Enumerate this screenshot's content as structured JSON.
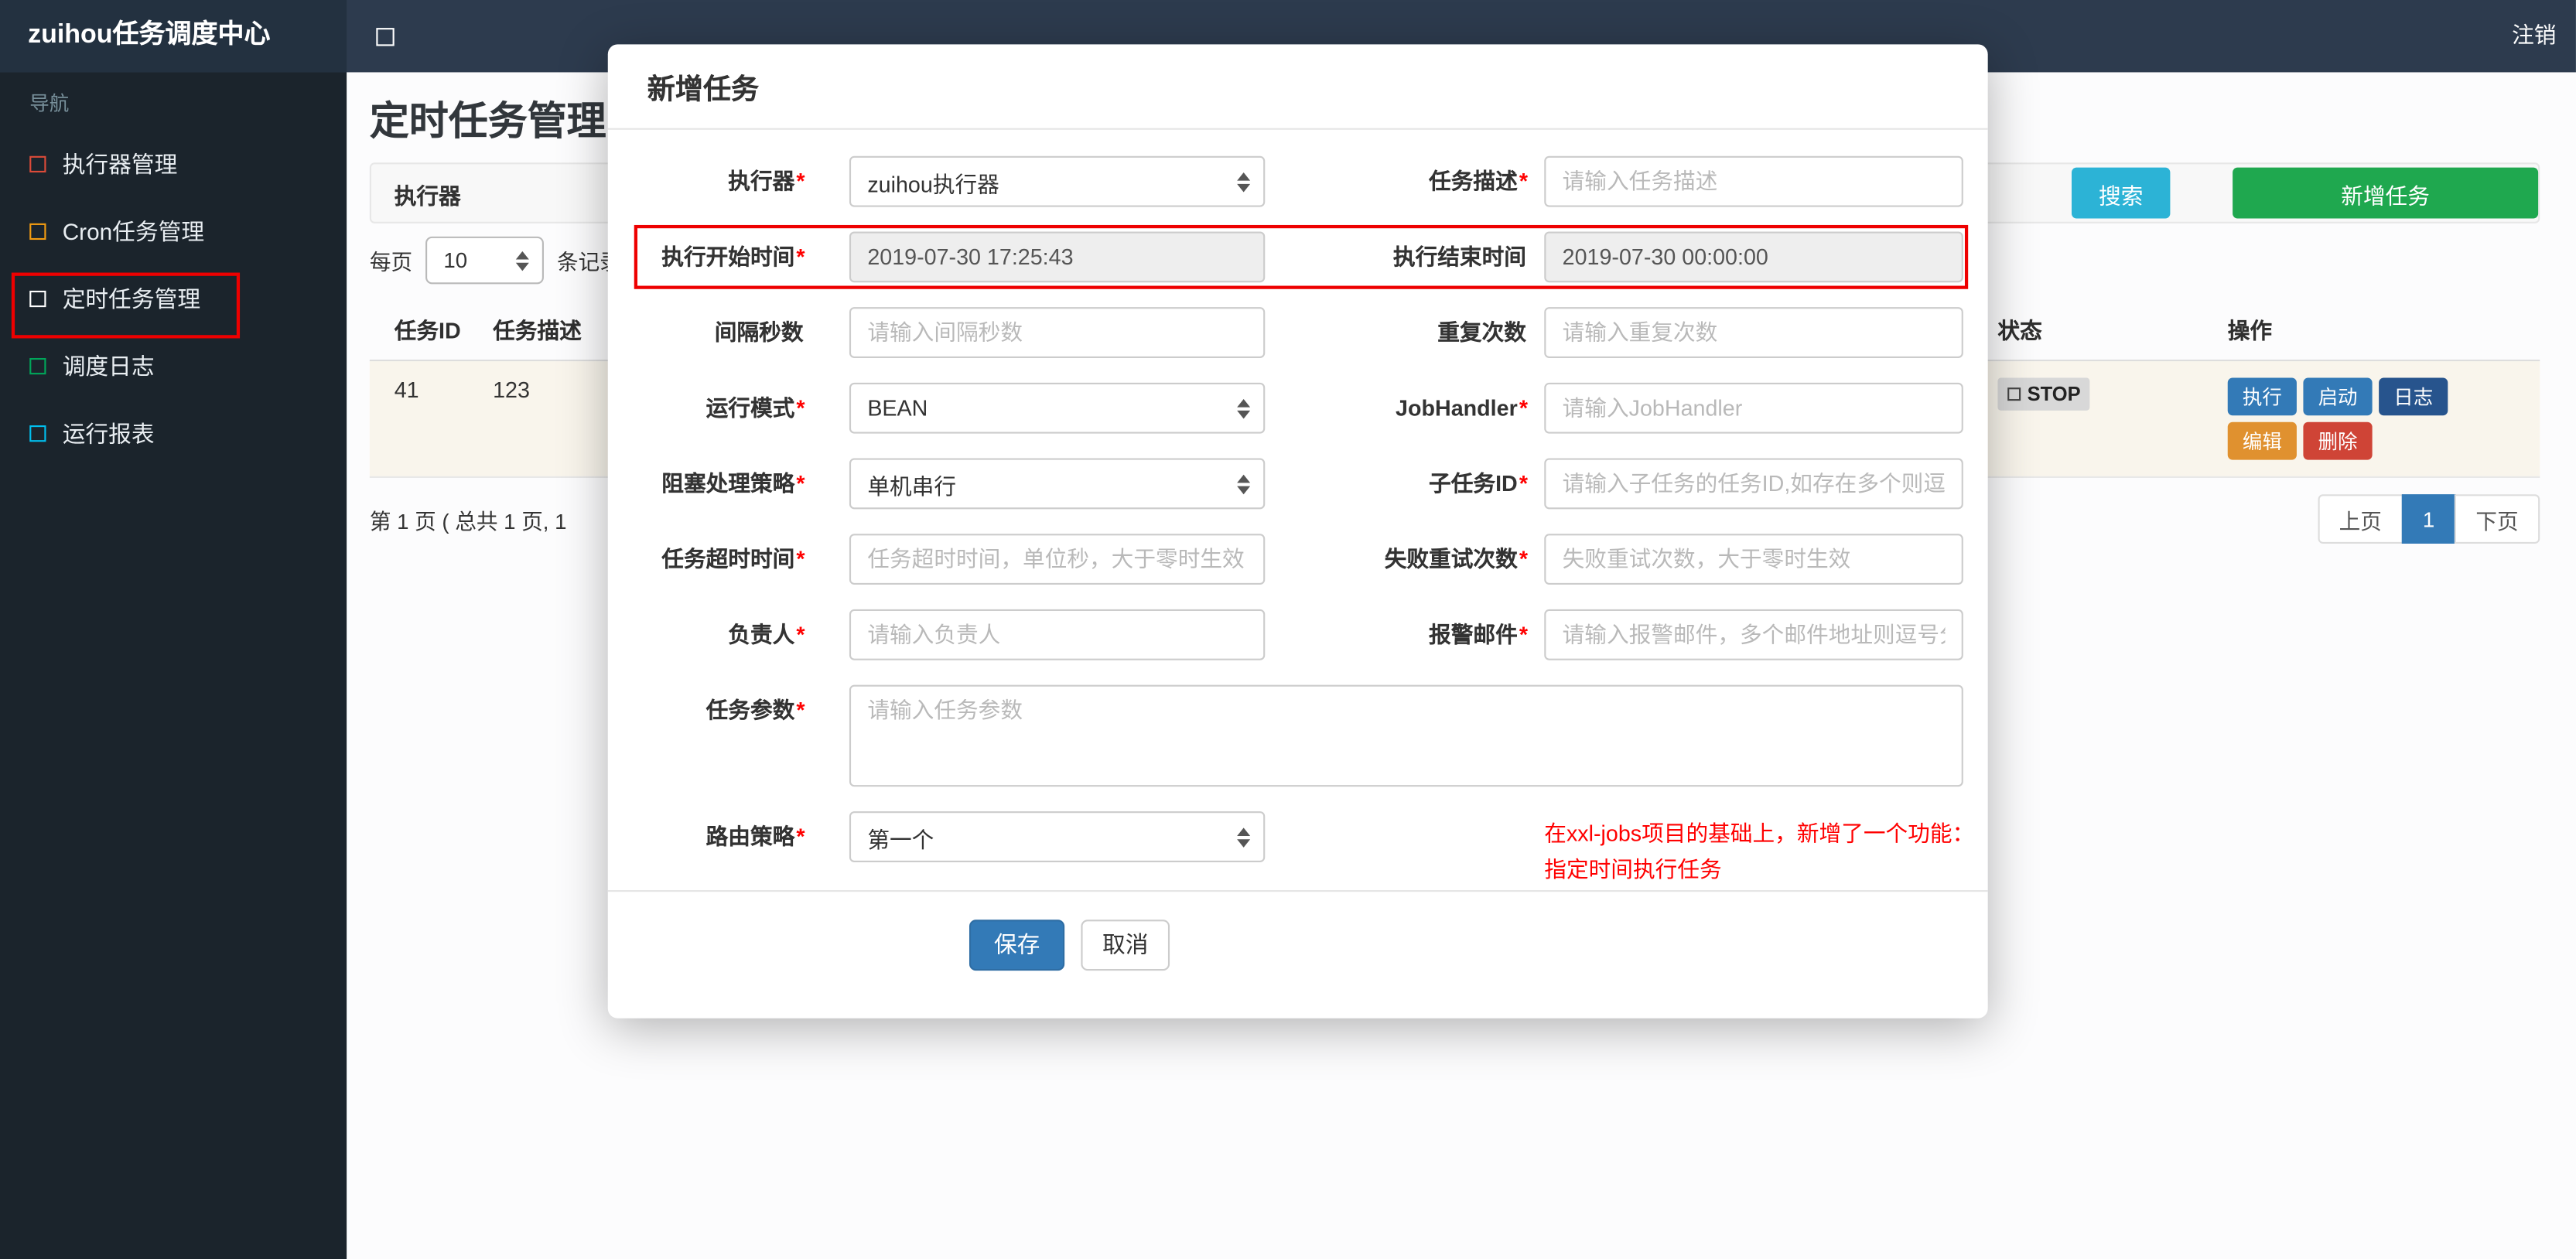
{
  "colors": {
    "navbar_bg": "#2d3b4e",
    "brand_bg": "#233140",
    "sidebar_bg": "#1b242c",
    "accent_blue": "#337ab7",
    "search_button_bg": "#2cb3d6",
    "add_button_bg": "#1fa84f",
    "annotation_red": "#ee0000",
    "note_red": "#ff0000",
    "status_badge_bg": "#d8d8d8",
    "readonly_field_bg": "#eeeeee"
  },
  "navbar": {
    "brand": "zuihou任务调度中心",
    "logout": "注销"
  },
  "sidebar": {
    "header": "导航",
    "items": [
      {
        "label": "执行器管理",
        "icon_color": "#dd4b39"
      },
      {
        "label": "Cron任务管理",
        "icon_color": "#f39c12"
      },
      {
        "label": "定时任务管理",
        "icon_color": "#ffffff"
      },
      {
        "label": "调度日志",
        "icon_color": "#00a65a"
      },
      {
        "label": "运行报表",
        "icon_color": "#00c0ef"
      }
    ]
  },
  "page": {
    "title": "定时任务管理",
    "filter_label": "执行器",
    "search_button": "搜索",
    "add_button": "新增任务",
    "per_page_label": "每页",
    "per_page_value": "10",
    "per_page_suffix": "条记录",
    "table": {
      "headers": {
        "id": "任务ID",
        "desc": "任务描述",
        "status": "状态",
        "ops": "操作"
      },
      "row": {
        "id": "41",
        "desc": "123",
        "status": "STOP",
        "actions": [
          {
            "label": "执行",
            "color": "#337ab7"
          },
          {
            "label": "启动",
            "color": "#337ab7"
          },
          {
            "label": "日志",
            "color": "#27548d"
          },
          {
            "label": "编辑",
            "color": "#e0912f"
          },
          {
            "label": "删除",
            "color": "#cf4436"
          }
        ]
      }
    },
    "pagination": {
      "summary": "第 1 页 ( 总共 1 页, 1",
      "prev": "上页",
      "current": "1",
      "next": "下页"
    }
  },
  "modal": {
    "title": "新增任务",
    "rows": [
      {
        "left": {
          "label": "执行器",
          "req": "*",
          "value": "zuihou执行器"
        },
        "right": {
          "label": "任务描述",
          "req": "*",
          "placeholder": "请输入任务描述"
        }
      },
      {
        "left": {
          "label": "执行开始时间",
          "req": "*",
          "value": "2019-07-30 17:25:43"
        },
        "right": {
          "label": "执行结束时间",
          "req": "",
          "value": "2019-07-30 00:00:00"
        }
      },
      {
        "left": {
          "label": "间隔秒数",
          "req": "",
          "placeholder": "请输入间隔秒数"
        },
        "right": {
          "label": "重复次数",
          "req": "",
          "placeholder": "请输入重复次数"
        }
      },
      {
        "left": {
          "label": "运行模式",
          "req": "*",
          "value": "BEAN"
        },
        "right": {
          "label": "JobHandler",
          "req": "*",
          "placeholder": "请输入JobHandler"
        }
      },
      {
        "left": {
          "label": "阻塞处理策略",
          "req": "*",
          "value": "单机串行"
        },
        "right": {
          "label": "子任务ID",
          "req": "*",
          "placeholder": "请输入子任务的任务ID,如存在多个则逗号分隔"
        }
      },
      {
        "left": {
          "label": "任务超时时间",
          "req": "*",
          "placeholder": "任务超时时间，单位秒，大于零时生效"
        },
        "right": {
          "label": "失败重试次数",
          "req": "*",
          "placeholder": "失败重试次数，大于零时生效"
        }
      },
      {
        "left": {
          "label": "负责人",
          "req": "*",
          "placeholder": "请输入负责人"
        },
        "right": {
          "label": "报警邮件",
          "req": "*",
          "placeholder": "请输入报警邮件，多个邮件地址则逗号分隔"
        }
      }
    ],
    "param": {
      "label": "任务参数",
      "req": "*",
      "placeholder": "请输入任务参数"
    },
    "route": {
      "label": "路由策略",
      "req": "*",
      "value": "第一个"
    },
    "note_line1": "在xxl-jobs项目的基础上，新增了一个功能：",
    "note_line2": "指定时间执行任务",
    "save_button": "保存",
    "cancel_button": "取消"
  }
}
